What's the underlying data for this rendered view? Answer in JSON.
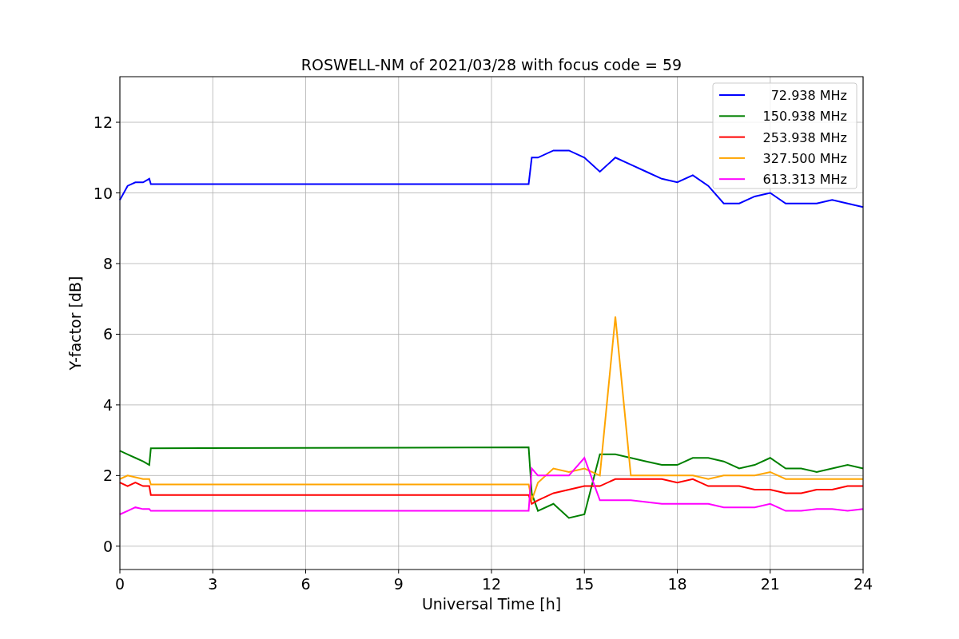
{
  "figure": {
    "chart_data": {
      "type": "line",
      "title": "ROSWELL-NM of 2021/03/28 with focus code = 59",
      "xlabel": "Universal Time [h]",
      "ylabel": "Y-factor [dB]",
      "x": [
        0,
        0.25,
        0.5,
        0.75,
        0.95,
        1.0,
        13.2,
        13.3,
        13.5,
        14,
        14.5,
        15,
        15.5,
        16,
        16.5,
        17,
        17.5,
        18,
        18.5,
        19,
        19.5,
        20,
        20.5,
        21,
        21.5,
        22,
        22.5,
        23,
        23.5,
        24
      ],
      "series": [
        {
          "name": "72.938 MHz",
          "color": "#0000ff",
          "values": [
            9.8,
            10.2,
            10.3,
            10.3,
            10.4,
            10.25,
            10.25,
            11.0,
            11.0,
            11.2,
            11.2,
            11.0,
            10.6,
            11.0,
            10.8,
            10.6,
            10.4,
            10.3,
            10.5,
            10.2,
            9.7,
            9.7,
            9.9,
            10.0,
            9.7,
            9.7,
            9.7,
            9.8,
            9.7,
            9.6
          ]
        },
        {
          "name": "150.938 MHz",
          "color": "#008000",
          "values": [
            2.7,
            2.6,
            2.5,
            2.4,
            2.3,
            2.77,
            2.8,
            1.5,
            1.0,
            1.2,
            0.8,
            0.9,
            2.6,
            2.6,
            2.5,
            2.4,
            2.3,
            2.3,
            2.5,
            2.5,
            2.4,
            2.2,
            2.3,
            2.5,
            2.2,
            2.2,
            2.1,
            2.2,
            2.3,
            2.2
          ]
        },
        {
          "name": "253.938 MHz",
          "color": "#ff0000",
          "values": [
            1.8,
            1.7,
            1.8,
            1.7,
            1.7,
            1.45,
            1.45,
            1.2,
            1.3,
            1.5,
            1.6,
            1.7,
            1.7,
            1.9,
            1.9,
            1.9,
            1.9,
            1.8,
            1.9,
            1.7,
            1.7,
            1.7,
            1.6,
            1.6,
            1.5,
            1.5,
            1.6,
            1.6,
            1.7,
            1.7
          ]
        },
        {
          "name": "327.500 MHz",
          "color": "#ffa500",
          "values": [
            1.9,
            2.0,
            1.95,
            1.9,
            1.9,
            1.75,
            1.75,
            1.3,
            1.8,
            2.2,
            2.1,
            2.2,
            2.0,
            6.5,
            2.0,
            2.0,
            2.0,
            2.0,
            2.0,
            1.9,
            2.0,
            2.0,
            2.0,
            2.1,
            1.9,
            1.9,
            1.9,
            1.9,
            1.9,
            1.9
          ]
        },
        {
          "name": "613.313 MHz",
          "color": "#ff00ff",
          "values": [
            0.9,
            1.0,
            1.1,
            1.05,
            1.05,
            1.0,
            1.0,
            2.2,
            2.0,
            2.0,
            2.0,
            2.5,
            1.3,
            1.3,
            1.3,
            1.25,
            1.2,
            1.2,
            1.2,
            1.2,
            1.1,
            1.1,
            1.1,
            1.2,
            1.0,
            1.0,
            1.05,
            1.05,
            1.0,
            1.05
          ]
        }
      ],
      "xlim": [
        0,
        24
      ],
      "ylim": [
        -0.66,
        13.29
      ],
      "xticks": [
        0,
        3,
        6,
        9,
        12,
        15,
        18,
        21,
        24
      ],
      "yticks": [
        0,
        2,
        4,
        6,
        8,
        10,
        12
      ],
      "grid": true,
      "legend": true
    }
  }
}
